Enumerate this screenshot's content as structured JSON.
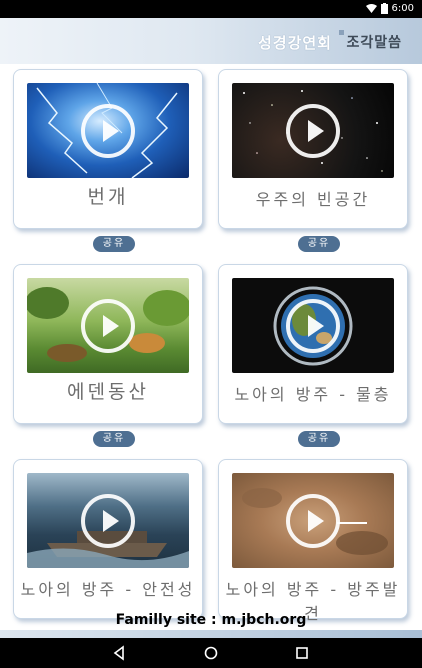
{
  "status": {
    "time": "6:00"
  },
  "header": {
    "title": "성경강연회",
    "subtitle": "조각말씀"
  },
  "cards": [
    {
      "title": "번개",
      "share": "공유"
    },
    {
      "title": "우주의 빈공간",
      "share": "공유"
    },
    {
      "title": "에덴동산",
      "share": "공유"
    },
    {
      "title": "노아의 방주 - 물층",
      "share": "공유"
    },
    {
      "title": "노아의 방주 - 안전성"
    },
    {
      "title": "노아의 방주 - 방주발견"
    }
  ],
  "footer": {
    "text": "Familly site : m.jbch.org"
  },
  "icons": {
    "wifi": "wifi-icon",
    "battery": "battery-icon",
    "play": "play-icon",
    "back": "back-icon",
    "home": "home-icon",
    "recents": "recents-icon"
  },
  "colors": {
    "accent": "#4e6f92",
    "header": "#b7c9dc"
  }
}
